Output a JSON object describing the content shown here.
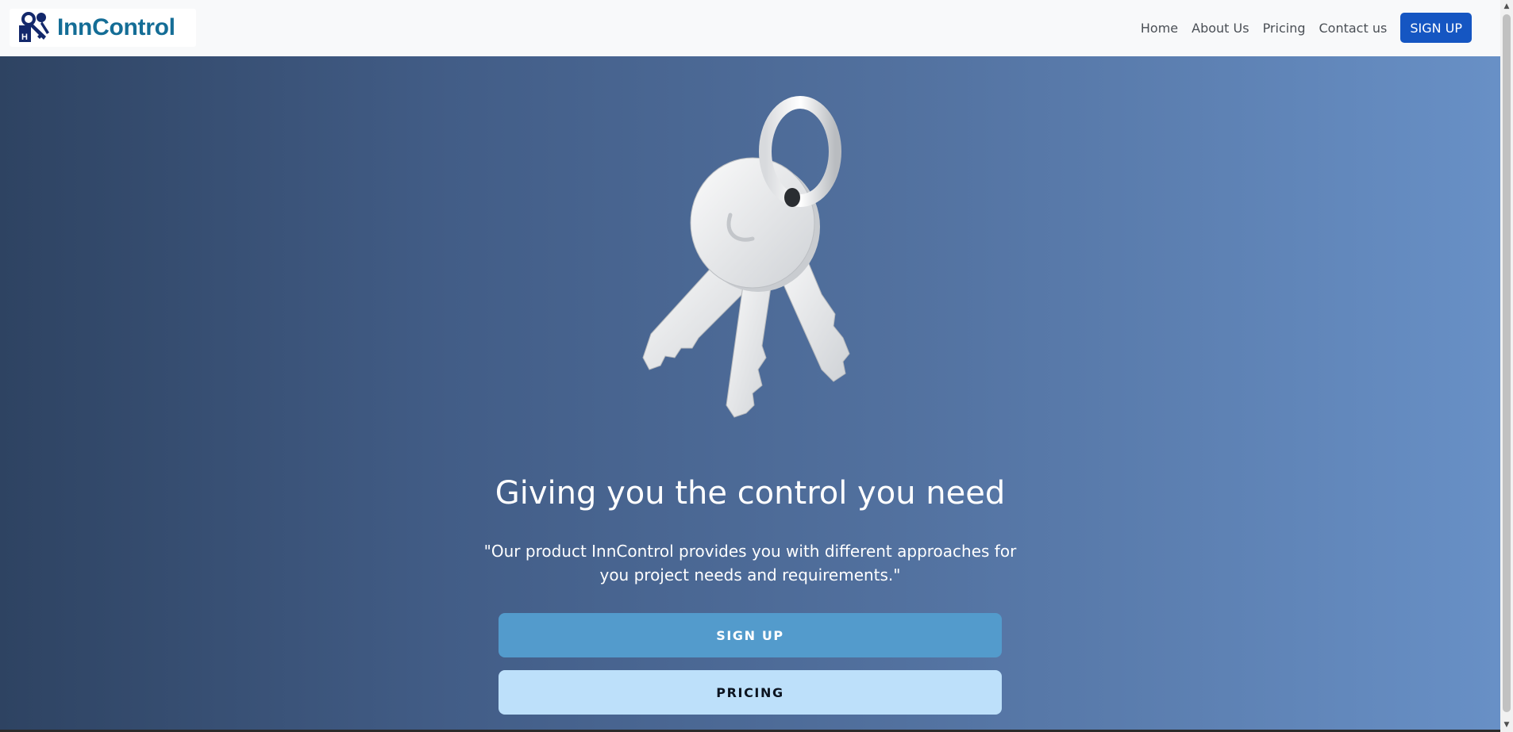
{
  "brand": {
    "name": "InnControl",
    "logo": "key-house-logo-icon"
  },
  "nav": {
    "links": [
      "Home",
      "About Us",
      "Pricing",
      "Contact us"
    ],
    "signup_label": "SIGN UP"
  },
  "hero": {
    "illustration": "keys-icon",
    "title": "Giving you the control you need",
    "quote": "\"Our product InnControl provides you with different approaches for you project needs and requirements.\"",
    "primary_button": "SIGN UP",
    "secondary_button": "PRICING"
  },
  "colors": {
    "brand_text": "#146d96",
    "nav_signup": "#1556c2",
    "hero_gradient_start": "#2e4362",
    "hero_gradient_end": "#6890c6",
    "hero_button_primary": "#539bcc",
    "hero_button_secondary": "#bde0fa"
  }
}
